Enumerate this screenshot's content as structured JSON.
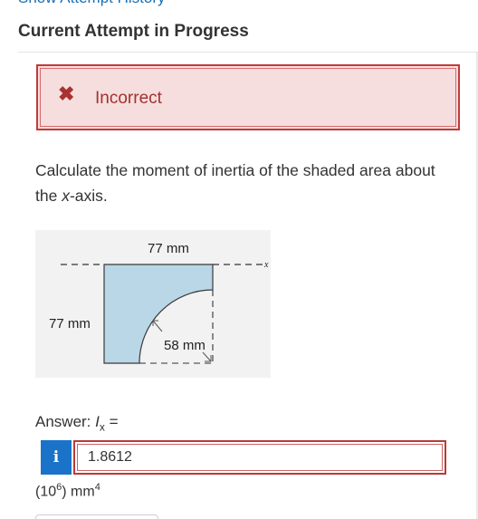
{
  "header": {
    "top_link": "Show Attempt History",
    "title": "Current Attempt in Progress"
  },
  "alert": {
    "icon": "close-icon",
    "text": "Incorrect",
    "colors": {
      "background": "#f6dede",
      "border": "#c03b3b",
      "text": "#a33131"
    }
  },
  "question": {
    "text_before": "Calculate the moment of inertia of the shaded area about the ",
    "axis": "x",
    "text_after": "-axis."
  },
  "figure": {
    "top_dim": "77 mm",
    "left_dim": "77 mm",
    "radius_dim": "58 mm",
    "axis_label": "x",
    "shaded_color": "#b9d7e7"
  },
  "answer": {
    "label_prefix": "Answer: ",
    "variable": "I",
    "subscript": "x",
    "label_suffix": " =",
    "info_label": "i",
    "value": "1.8612",
    "units_base": "(10",
    "units_exp": "6",
    "units_rest": ") mm",
    "units_exp2": "4"
  }
}
